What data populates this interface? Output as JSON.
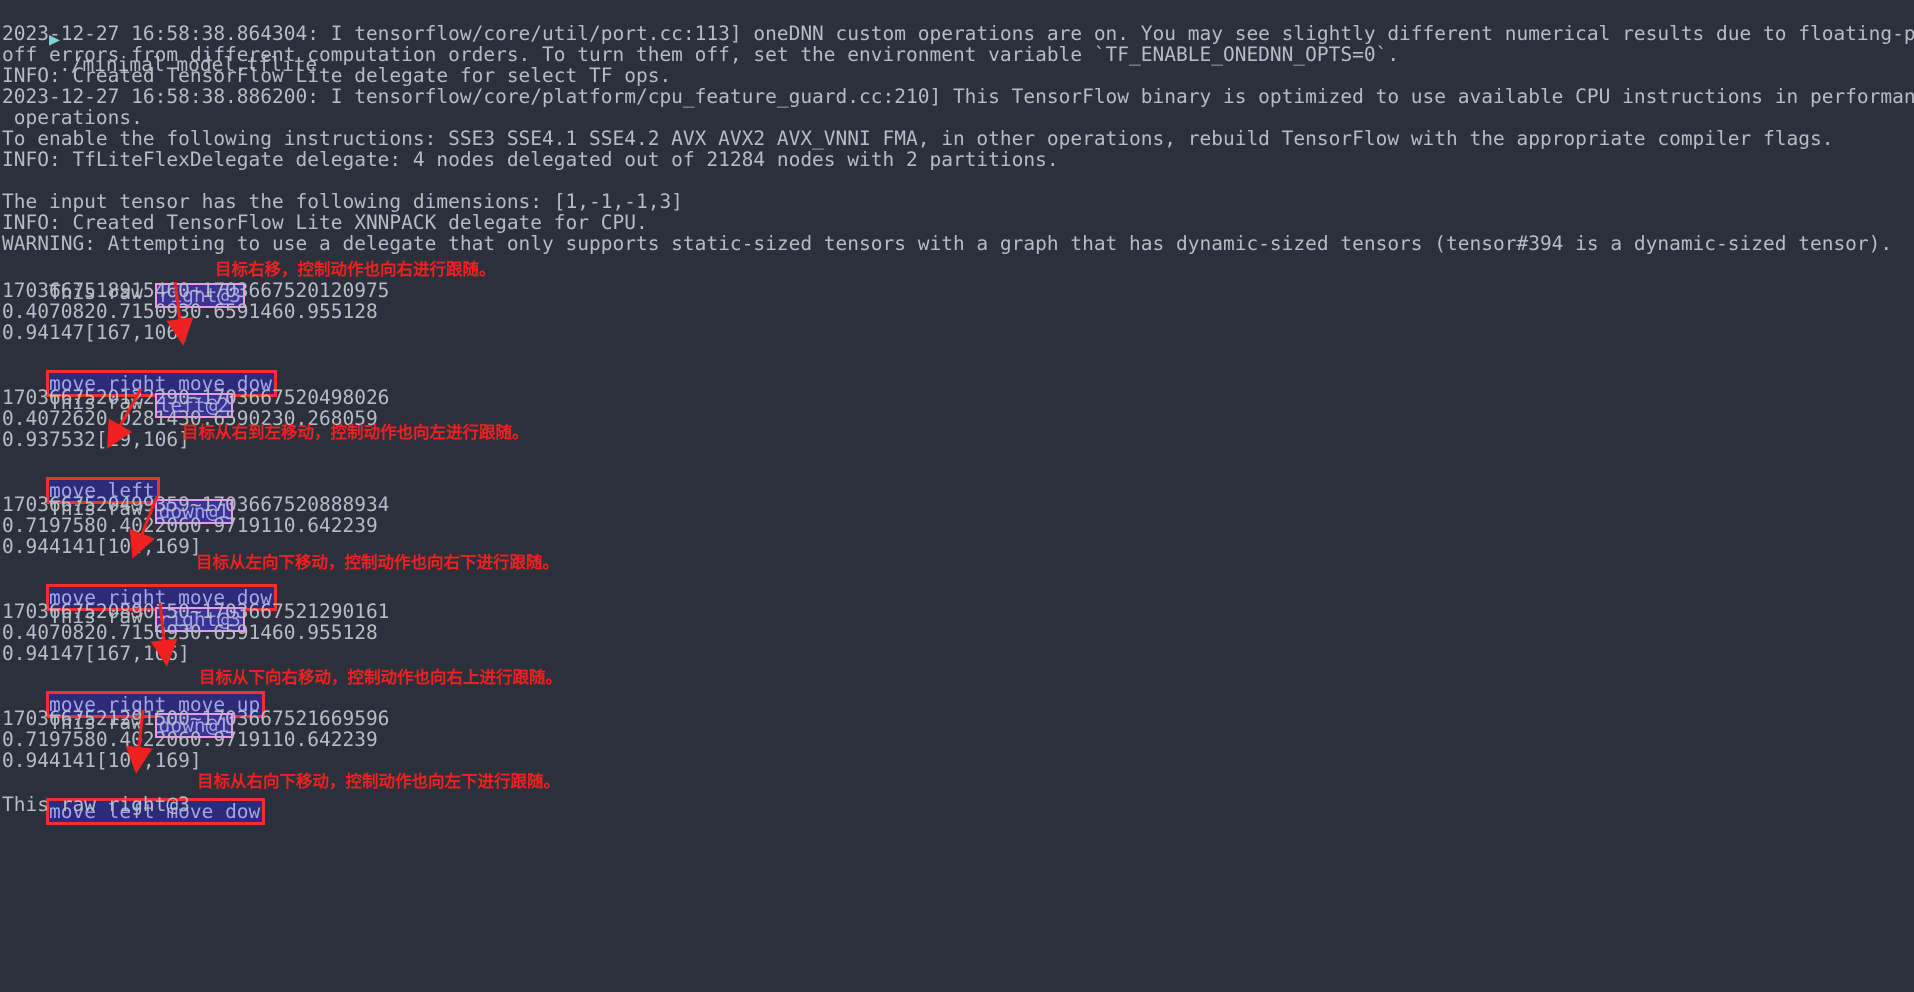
{
  "terminal": {
    "background_color": "#2b303b",
    "text_color": "#b7bcc4",
    "prompt_arrow": "▶",
    "prompt_arrow_color": "#7fd3d8",
    "command": "./minimal model.tflite",
    "highlight_chip": {
      "fill": "#3b3292",
      "border": "#e89ae8",
      "text": "#9fa6e8"
    },
    "action_box": {
      "fill": "#2e2a7a",
      "border": "#f03030",
      "text": "#9fa6e8"
    },
    "annotation_color": "#f02020",
    "log_lines": [
      "2023-12-27 16:58:38.864304: I tensorflow/core/util/port.cc:113] oneDNN custom operations are on. You may see slightly different numerical results due to floating-point round-",
      "off errors from different computation orders. To turn them off, set the environment variable `TF_ENABLE_ONEDNN_OPTS=0`.",
      "INFO: Created TensorFlow Lite delegate for select TF ops.",
      "2023-12-27 16:58:38.886200: I tensorflow/core/platform/cpu_feature_guard.cc:210] This TensorFlow binary is optimized to use available CPU instructions in performance-critical",
      " operations.",
      "To enable the following instructions: SSE3 SSE4.1 SSE4.2 AVX AVX2 AVX_VNNI FMA, in other operations, rebuild TensorFlow with the appropriate compiler flags.",
      "INFO: TfLiteFlexDelegate delegate: 4 nodes delegated out of 21284 nodes with 2 partitions.",
      "",
      "The input tensor has the following dimensions: [1,-1,-1,3]",
      "INFO: Created TensorFlow Lite XNNPACK delegate for CPU.",
      "WARNING: Attempting to use a delegate that only supports static-sized tensors with a graph that has dynamic-sized tensors (tensor#394 is a dynamic-sized tensor)."
    ],
    "blocks": [
      {
        "raw_prefix": "This raw ",
        "raw_value": "right@3",
        "timestamps": "1703667518915460~1703667520120975",
        "scores": "0.4070820.7150930.6591460.955128",
        "confidence_coords": "0.94147[167,106]",
        "action": "move right move dow",
        "annotation": "目标右移，控制动作也向右进行跟随。"
      },
      {
        "raw_prefix": "This raw ",
        "raw_value": "left@2",
        "timestamps": "1703667520122290~1703667520498026",
        "scores": "0.4072620.0281430.6590230.268059",
        "confidence_coords": "0.937532[29,106]",
        "action": "move left",
        "annotation": "目标从右到左移动，控制动作也向左进行跟随。"
      },
      {
        "raw_prefix": "This raw ",
        "raw_value": "down@1",
        "timestamps": "1703667520499359~1703667520888934",
        "scores": "0.7197580.4022060.9719110.642239",
        "confidence_coords": "0.944141[104,169]",
        "action": "move right move dow",
        "annotation": "目标从左向下移动，控制动作也向右下进行跟随。"
      },
      {
        "raw_prefix": "This raw ",
        "raw_value": "right@3",
        "timestamps": "1703667520890150~1703667521290161",
        "scores": "0.4070820.7150930.6591460.955128",
        "confidence_coords": "0.94147[167,106]",
        "action": "move right move up",
        "annotation": "目标从下向右移动，控制动作也向右上进行跟随。"
      },
      {
        "raw_prefix": "This raw ",
        "raw_value": "down@1",
        "timestamps": "1703667521291500~1703667521669596",
        "scores": "0.7197580.4022060.9719110.642239",
        "confidence_coords": "0.944141[104,169]",
        "action": "move left move dow",
        "annotation": "目标从右向下移动，控制动作也向左下进行跟随。"
      }
    ],
    "last_line": "This raw right@3"
  }
}
